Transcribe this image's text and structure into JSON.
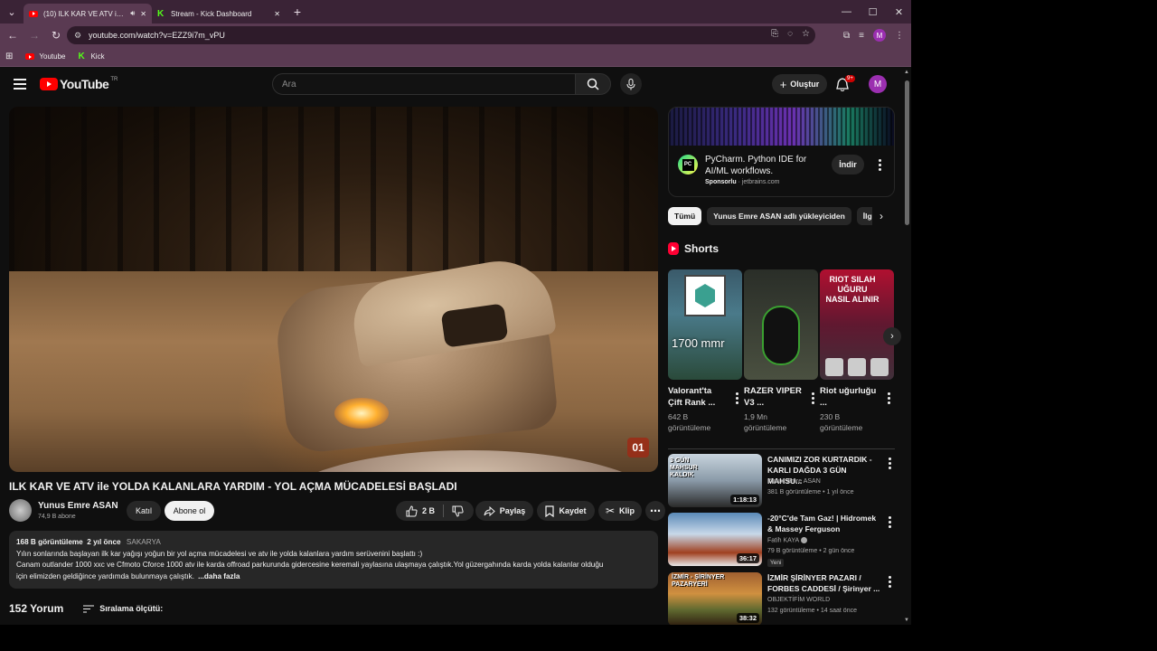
{
  "browser": {
    "tabs": [
      {
        "title": "(10) ILK KAR VE ATV ile YOL",
        "active": true
      },
      {
        "title": "Stream - Kick Dashboard",
        "active": false
      }
    ],
    "url": "youtube.com/watch?v=EZZ9i7m_vPU",
    "profile_initial": "M",
    "bookmarks": [
      {
        "label": "Youtube",
        "icon": "youtube-icon"
      },
      {
        "label": "Kick",
        "icon": "kick-icon"
      }
    ]
  },
  "masthead": {
    "logo_text": "YouTube",
    "country_code": "TR",
    "search_placeholder": "Ara",
    "create_label": "Oluştur",
    "notification_count": "9+",
    "avatar_initial": "M"
  },
  "video": {
    "watermark_text": "01",
    "title": "ILK KAR VE ATV ile YOLDA KALANLARA YARDIM - YOL AÇMA MÜCADELESİ BAŞLADI",
    "channel_name": "Yunus Emre ASAN",
    "subscribers": "74,9 B abone",
    "join_label": "Katıl",
    "subscribe_label": "Abone ol",
    "likes": "2 B",
    "share_label": "Paylaş",
    "save_label": "Kaydet",
    "clip_label": "Klip"
  },
  "description": {
    "views": "168 B görüntüleme",
    "date": "2 yıl önce",
    "location": "SAKARYA",
    "line1": "Yılın sonlarında başlayan ilk kar yağışı yoğun bir yol açma mücadelesi ve atv ile yolda kalanlara yardım serüvenini başlattı :)",
    "line2": "Canam outlander 1000 xxc ve Cfmoto Cforce 1000 atv ile karda offroad parkurunda gidercesine keremali yaylasına ulaşmaya çalıştık.Yol güzergahında karda yolda kalanlar olduğu",
    "line3": "için elimizden geldiğince yardımda bulunmaya çalıştık.",
    "more_label": "...daha fazla"
  },
  "comments": {
    "count": "152 Yorum",
    "sort_label": "Sıralama ölçütü:"
  },
  "ad": {
    "logo_text": "PC",
    "title": "PyCharm. Python IDE for AI/ML workflows.",
    "sponsored": "Sponsorlu",
    "domain": "jetbrains.com",
    "cta": "İndir"
  },
  "chips": [
    {
      "label": "Tümü",
      "selected": true
    },
    {
      "label": "Yunus Emre ASAN adlı yükleyiciden",
      "selected": false
    },
    {
      "label": "İlg",
      "selected": false
    }
  ],
  "shorts": {
    "heading": "Shorts",
    "items": [
      {
        "title": "Valorant'ta Çift Rank ...",
        "views": "642 B görüntüleme",
        "overlay": "1700 mmr"
      },
      {
        "title": "RAZER VIPER V3 ...",
        "views": "1,9 Mn görüntüleme",
        "overlay": ""
      },
      {
        "title": "Riot uğurluğu ...",
        "views": "230 B görüntüleme",
        "overlay": "RIOT SILAH UĞURU NASIL ALINIR"
      }
    ]
  },
  "recommendations": [
    {
      "title": "CANIMIZI ZOR KURTARDIK - KARLI DAĞDA 3 GÜN MAHSU...",
      "channel": "Yunus Emre ASAN",
      "views": "381 B görüntüleme",
      "age": "1 yıl önce",
      "duration": "1:18:13",
      "thumb_text": "3 GÜN MAHSUR KALDIK",
      "verified": false,
      "new_badge": ""
    },
    {
      "title": "-20°C'de Tam Gaz! | Hidromek & Massey Ferguson",
      "channel": "Fatih KAYA",
      "views": "79 B görüntüleme",
      "age": "2 gün önce",
      "duration": "36:17",
      "thumb_text": "",
      "verified": true,
      "new_badge": "Yeni"
    },
    {
      "title": "İZMİR ŞİRİNYER PAZARI / FORBES CADDESİ / Şirinyer ...",
      "channel": "OBJEKTİFİM WORLD",
      "views": "132 görüntüleme",
      "age": "14 saat önce",
      "duration": "38:32",
      "thumb_text": "İZMİR - ŞİRİNYER PAZARYERİ",
      "verified": false,
      "new_badge": ""
    }
  ],
  "colors": {
    "youtube_red": "#ff0000",
    "background": "#0f0f0f",
    "chip_bg": "#272727",
    "browser_frame": "#5a3a52"
  }
}
